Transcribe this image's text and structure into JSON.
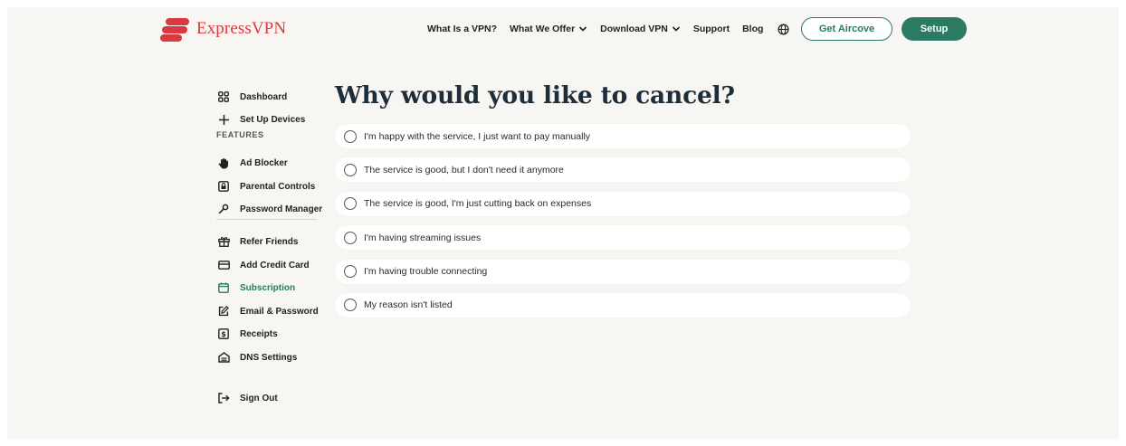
{
  "brand": {
    "name": "ExpressVPN",
    "color": "#da3940"
  },
  "header": {
    "nav": [
      {
        "label": "What Is a VPN?",
        "dropdown": false
      },
      {
        "label": "What We Offer",
        "dropdown": true
      },
      {
        "label": "Download VPN",
        "dropdown": true
      },
      {
        "label": "Support",
        "dropdown": false
      },
      {
        "label": "Blog",
        "dropdown": false
      }
    ],
    "language_icon": "globe-icon",
    "get_aircove_label": "Get Aircove",
    "setup_label": "Setup"
  },
  "sidebar": {
    "top_items": [
      {
        "label": "Dashboard",
        "icon": "grid-icon"
      },
      {
        "label": "Set Up Devices",
        "icon": "plus-icon"
      }
    ],
    "features_heading": "FEATURES",
    "feature_items": [
      {
        "label": "Ad Blocker",
        "icon": "hand-icon"
      },
      {
        "label": "Parental Controls",
        "icon": "lock-icon"
      },
      {
        "label": "Password Manager",
        "icon": "key-icon"
      }
    ],
    "account_items": [
      {
        "label": "Refer Friends",
        "icon": "gift-icon"
      },
      {
        "label": "Add Credit Card",
        "icon": "credit-card-icon"
      },
      {
        "label": "Subscription",
        "icon": "calendar-icon",
        "active": true
      },
      {
        "label": "Email & Password",
        "icon": "edit-icon"
      },
      {
        "label": "Receipts",
        "icon": "receipt-icon"
      },
      {
        "label": "DNS Settings",
        "icon": "dns-icon"
      }
    ],
    "sign_out": {
      "label": "Sign Out",
      "icon": "sign-out-icon"
    }
  },
  "main": {
    "title": "Why would you like to cancel?",
    "options": [
      "I'm happy with the service, I just want to pay manually",
      "The service is good, but I don't need it anymore",
      "The service is good, I'm just cutting back on expenses",
      "I'm having streaming issues",
      "I'm having trouble connecting",
      "My reason isn't listed"
    ]
  },
  "colors": {
    "accent": "#2b7a63",
    "background": "#f7f6f3"
  }
}
